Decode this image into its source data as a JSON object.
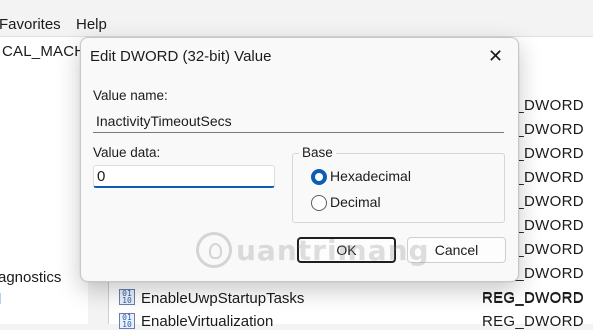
{
  "menubar": {
    "items": [
      "Favorites",
      "Help"
    ]
  },
  "address": {
    "text": "CAL_MACHINE"
  },
  "tree": {
    "items": [
      {
        "label": "agnostics",
        "selected": false
      },
      {
        "label": "l",
        "selected": true
      }
    ]
  },
  "list": {
    "rows": [
      {
        "name": "",
        "type": "REG_DWORD"
      },
      {
        "name": "",
        "type": "REG_DWORD"
      },
      {
        "name": "",
        "type": "REG_DWORD"
      },
      {
        "name": "",
        "type": "REG_DWORD"
      },
      {
        "name": "",
        "type": "REG_DWORD"
      },
      {
        "name": "",
        "type": "REG_DWORD"
      },
      {
        "name": "",
        "type": "REG_DWORD"
      },
      {
        "name": "",
        "type": "REG_DWORD"
      },
      {
        "name": "",
        "type": "REG_DWORD"
      },
      {
        "name": "EnableUwpStartupTasks",
        "type": "REG_DWORD"
      },
      {
        "name": "EnableVirtualization",
        "type": "REG_DWORD"
      }
    ]
  },
  "dialog": {
    "title": "Edit DWORD (32-bit) Value",
    "close_glyph": "✕",
    "value_name_label": "Value name:",
    "value_name": "InactivityTimeoutSecs",
    "value_data_label": "Value data:",
    "value_data": "0",
    "base_label": "Base",
    "base_options": [
      {
        "label": "Hexadecimal",
        "selected": true
      },
      {
        "label": "Decimal",
        "selected": false
      }
    ],
    "ok_label": "OK",
    "cancel_label": "Cancel"
  },
  "watermark": {
    "text": "uantrimang"
  },
  "colors": {
    "accent": "#0a5fb4",
    "dialog_bg": "#f9f9f9",
    "window_bg": "#f3f3f3"
  }
}
